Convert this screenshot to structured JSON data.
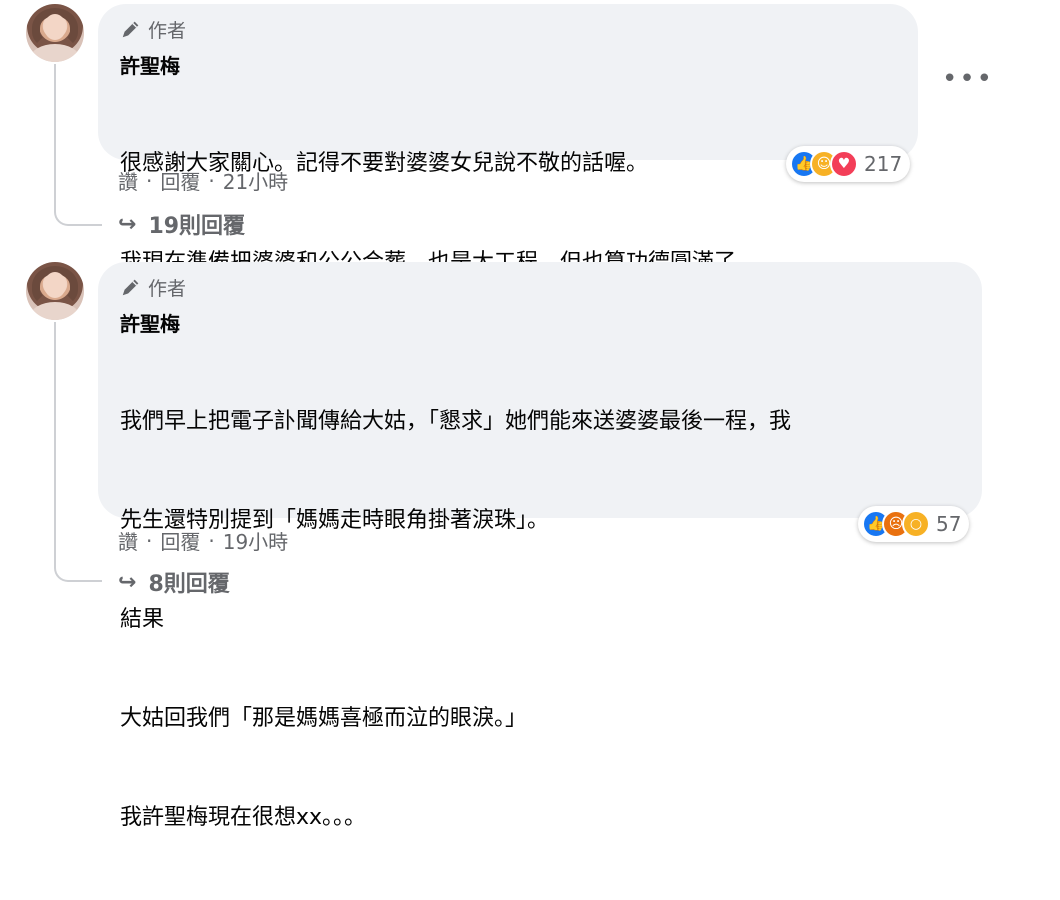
{
  "comments": [
    {
      "badge": "作者",
      "author": "許聖梅",
      "lines": [
        "很感謝大家關心。記得不要對婆婆女兒說不敬的話喔。",
        "我現在準備把婆婆和公公合葬，也是大工程，但也算功德圓滿了。"
      ],
      "like_label": "讚",
      "reply_label": "回覆",
      "time": "21小時",
      "reactions": [
        "like",
        "care",
        "love"
      ],
      "reaction_count": "217",
      "replies_label": "19則回覆"
    },
    {
      "badge": "作者",
      "author": "許聖梅",
      "lines": [
        "我們早上把電子訃聞傳給大姑，「懇求」她們能來送婆婆最後一程，我",
        "先生還特別提到「媽媽走時眼角掛著淚珠」。",
        "結果",
        "大姑回我們「那是媽媽喜極而泣的眼淚。」",
        "我許聖梅現在很想xx。。。"
      ],
      "like_label": "讚",
      "reply_label": "回覆",
      "time": "19小時",
      "reactions": [
        "like",
        "angry",
        "wow"
      ],
      "reaction_count": "57",
      "replies_label": "8則回覆"
    }
  ],
  "menu_icon": "more-horizontal-icon",
  "colors": {
    "bubble": "#f0f2f5",
    "meta": "#65676b",
    "like": "#1877f2",
    "love": "#f33e58"
  }
}
